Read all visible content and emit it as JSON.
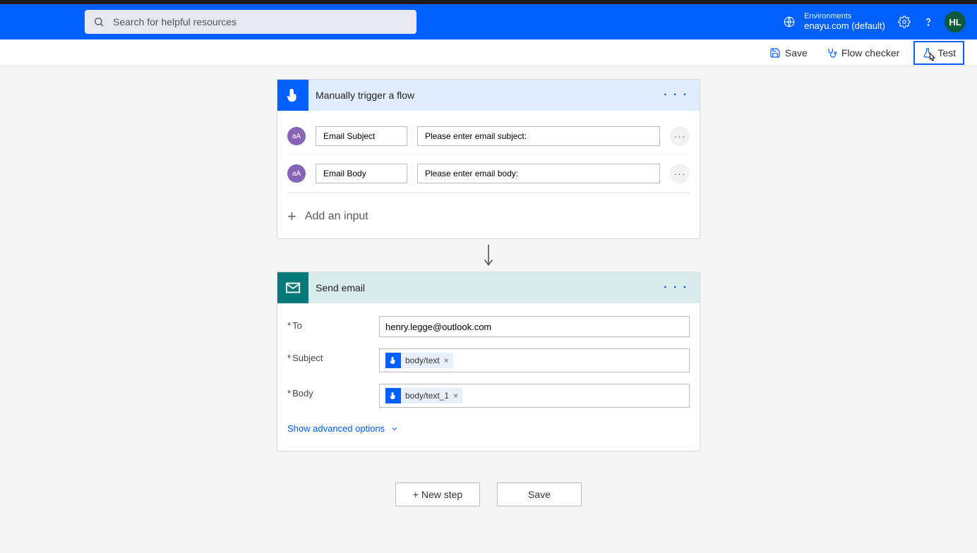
{
  "header": {
    "search_placeholder": "Search for helpful resources",
    "env_label": "Environments",
    "env_name": "enayu.com (default)",
    "avatar": "HL"
  },
  "toolbar": {
    "save": "Save",
    "flow_checker": "Flow checker",
    "test": "Test"
  },
  "trigger": {
    "title": "Manually trigger a flow",
    "inputs": [
      {
        "name": "Email Subject",
        "prompt": "Please enter email subject:"
      },
      {
        "name": "Email Body",
        "prompt": "Please enter email body:"
      }
    ],
    "add_input": "Add an input"
  },
  "email": {
    "title": "Send email",
    "to_label": "To",
    "to_value": "henry.legge@outlook.com",
    "subject_label": "Subject",
    "subject_token": "body/text",
    "body_label": "Body",
    "body_token": "body/text_1",
    "advanced": "Show advanced options"
  },
  "footer": {
    "new_step": "+ New step",
    "save": "Save"
  }
}
